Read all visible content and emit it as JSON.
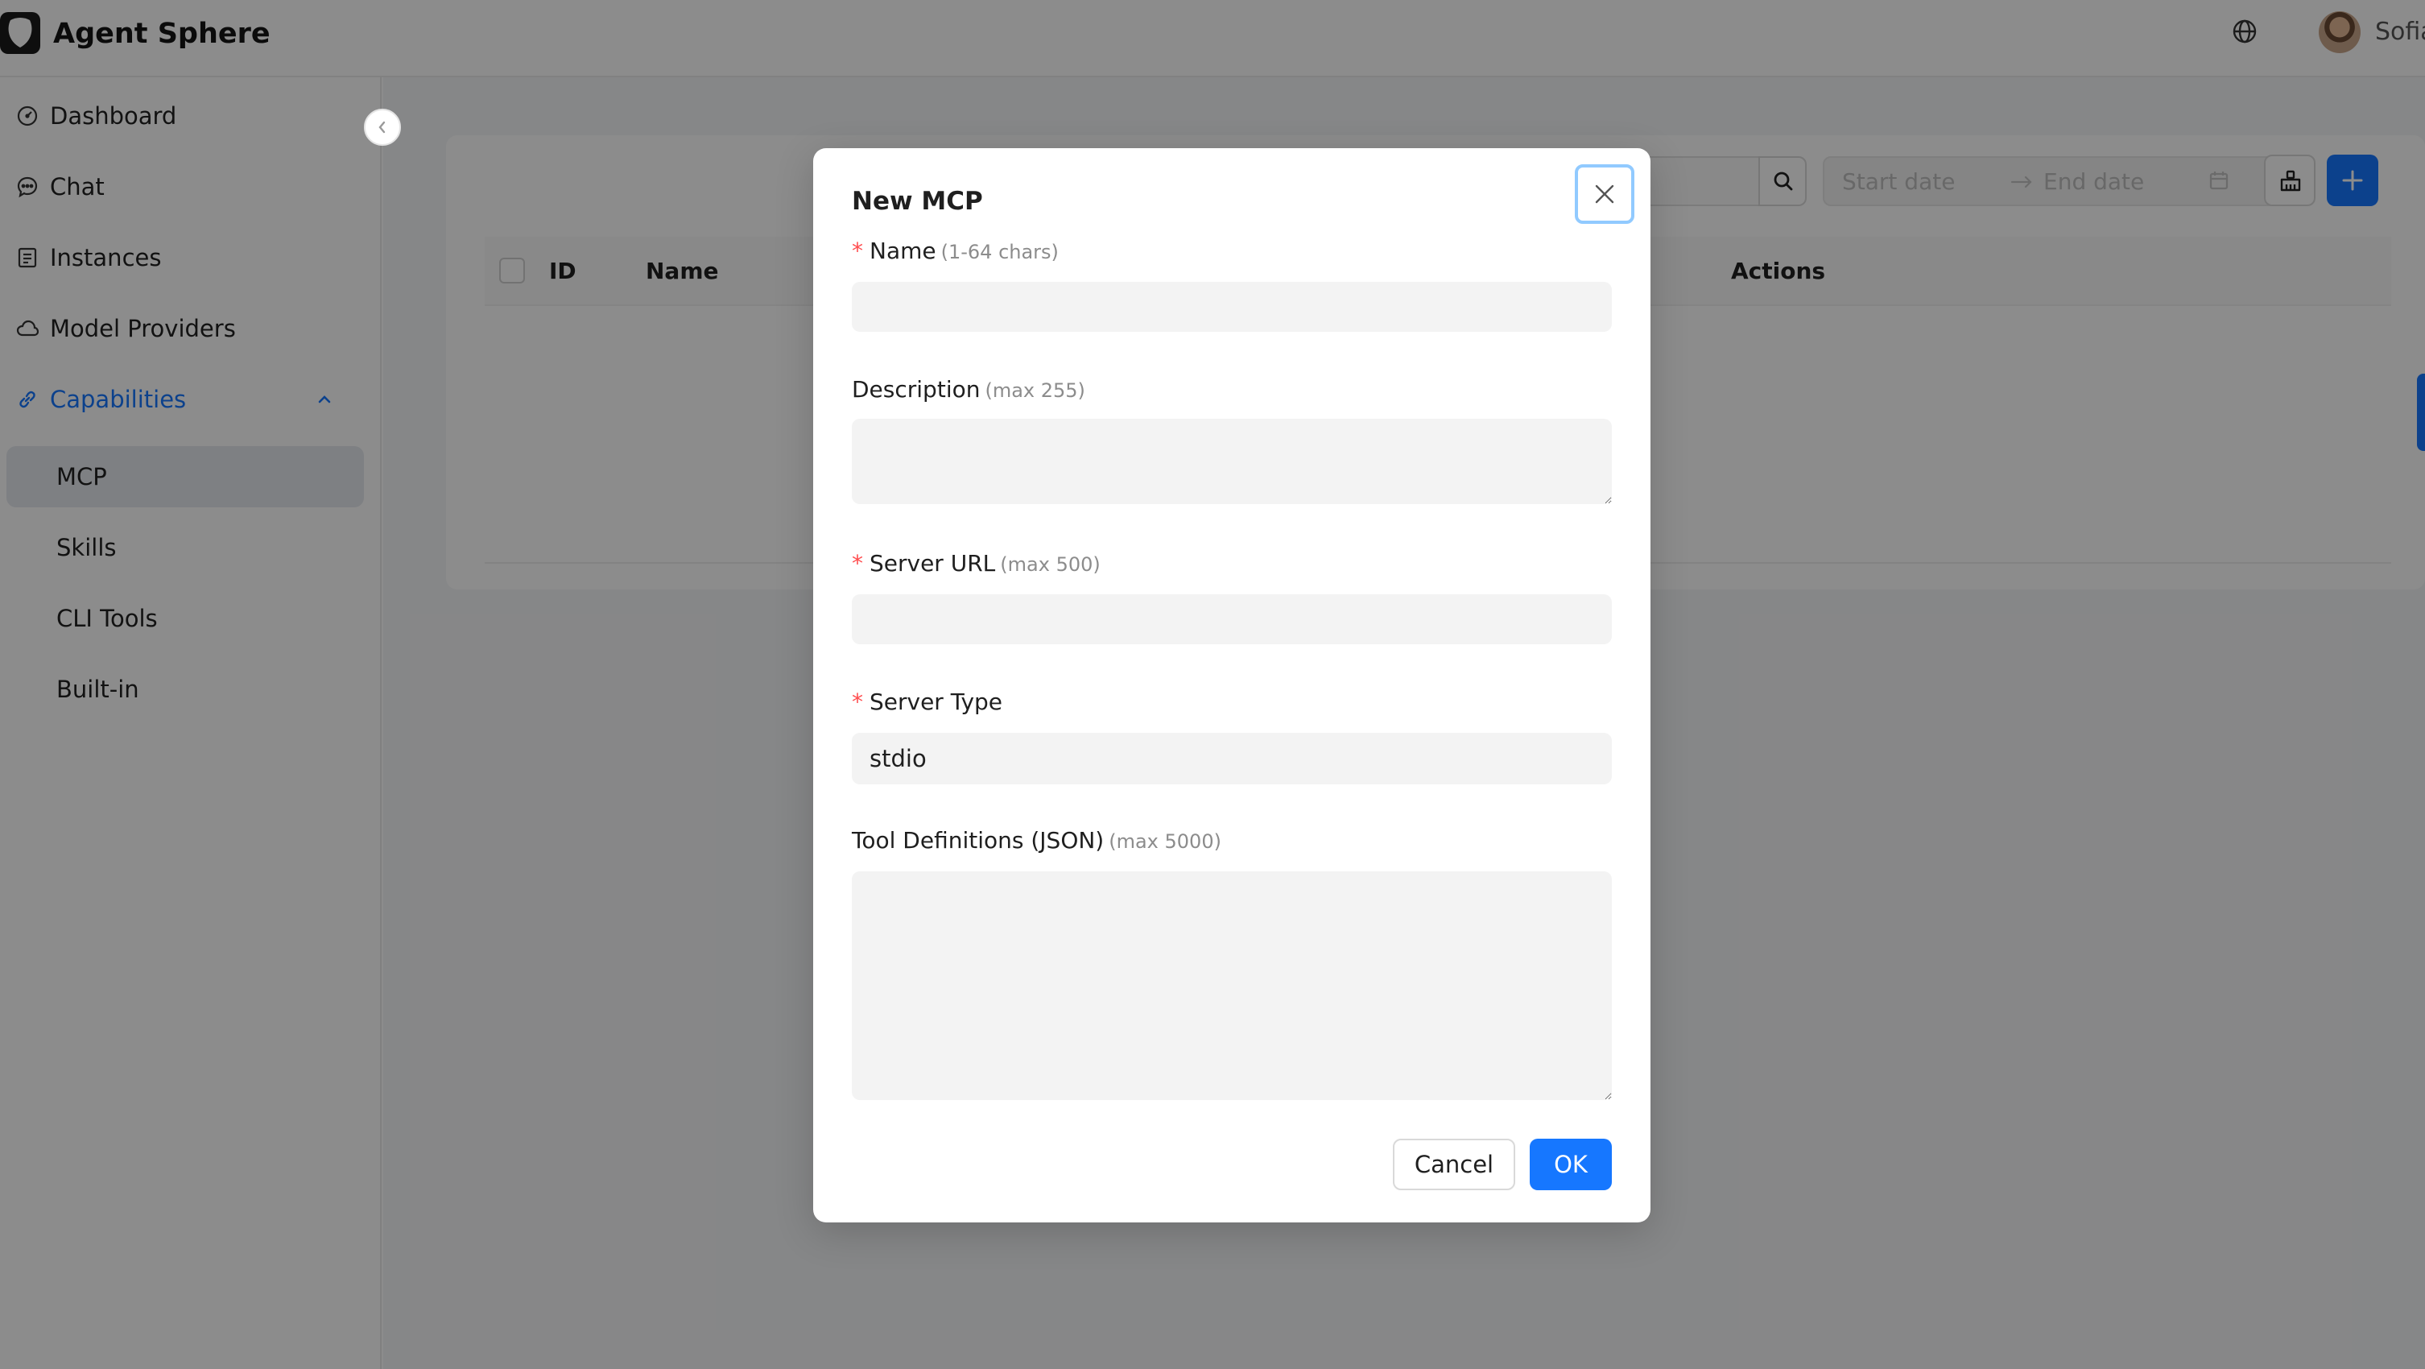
{
  "app": {
    "title": "Agent Sphere",
    "user_name": "Sofia"
  },
  "colors": {
    "accent": "#1677ff",
    "required": "#ff4d4f",
    "hint": "#8c8c8c"
  },
  "header": {
    "icons": [
      "logo-icon",
      "globe-icon"
    ]
  },
  "sidebar": {
    "items": [
      {
        "label": "Dashboard",
        "icon": "dashboard-icon"
      },
      {
        "label": "Chat",
        "icon": "chat-icon"
      },
      {
        "label": "Instances",
        "icon": "instances-icon"
      },
      {
        "label": "Model Providers",
        "icon": "cloud-icon"
      },
      {
        "label": "Capabilities",
        "icon": "link-icon",
        "expanded": true,
        "children": [
          {
            "label": "MCP",
            "selected": true
          },
          {
            "label": "Skills"
          },
          {
            "label": "CLI Tools"
          },
          {
            "label": "Built-in"
          }
        ]
      }
    ]
  },
  "toolbar": {
    "start_placeholder": "Start date",
    "end_placeholder": "End date"
  },
  "table": {
    "columns": [
      "ID",
      "Name",
      "Actions"
    ]
  },
  "modal": {
    "title": "New MCP",
    "fields": {
      "name": {
        "label": "Name",
        "hint": "(1-64 chars)",
        "required": true,
        "value": ""
      },
      "description": {
        "label": "Description",
        "hint": "(max 255)",
        "required": false,
        "value": ""
      },
      "server_url": {
        "label": "Server URL",
        "hint": "(max 500)",
        "required": true,
        "value": ""
      },
      "server_type": {
        "label": "Server Type",
        "required": true,
        "value": "stdio"
      },
      "tool_definitions": {
        "label": "Tool Definitions (JSON)",
        "hint": "(max 5000)",
        "required": false,
        "value": ""
      }
    },
    "buttons": {
      "cancel": "Cancel",
      "ok": "OK"
    }
  }
}
